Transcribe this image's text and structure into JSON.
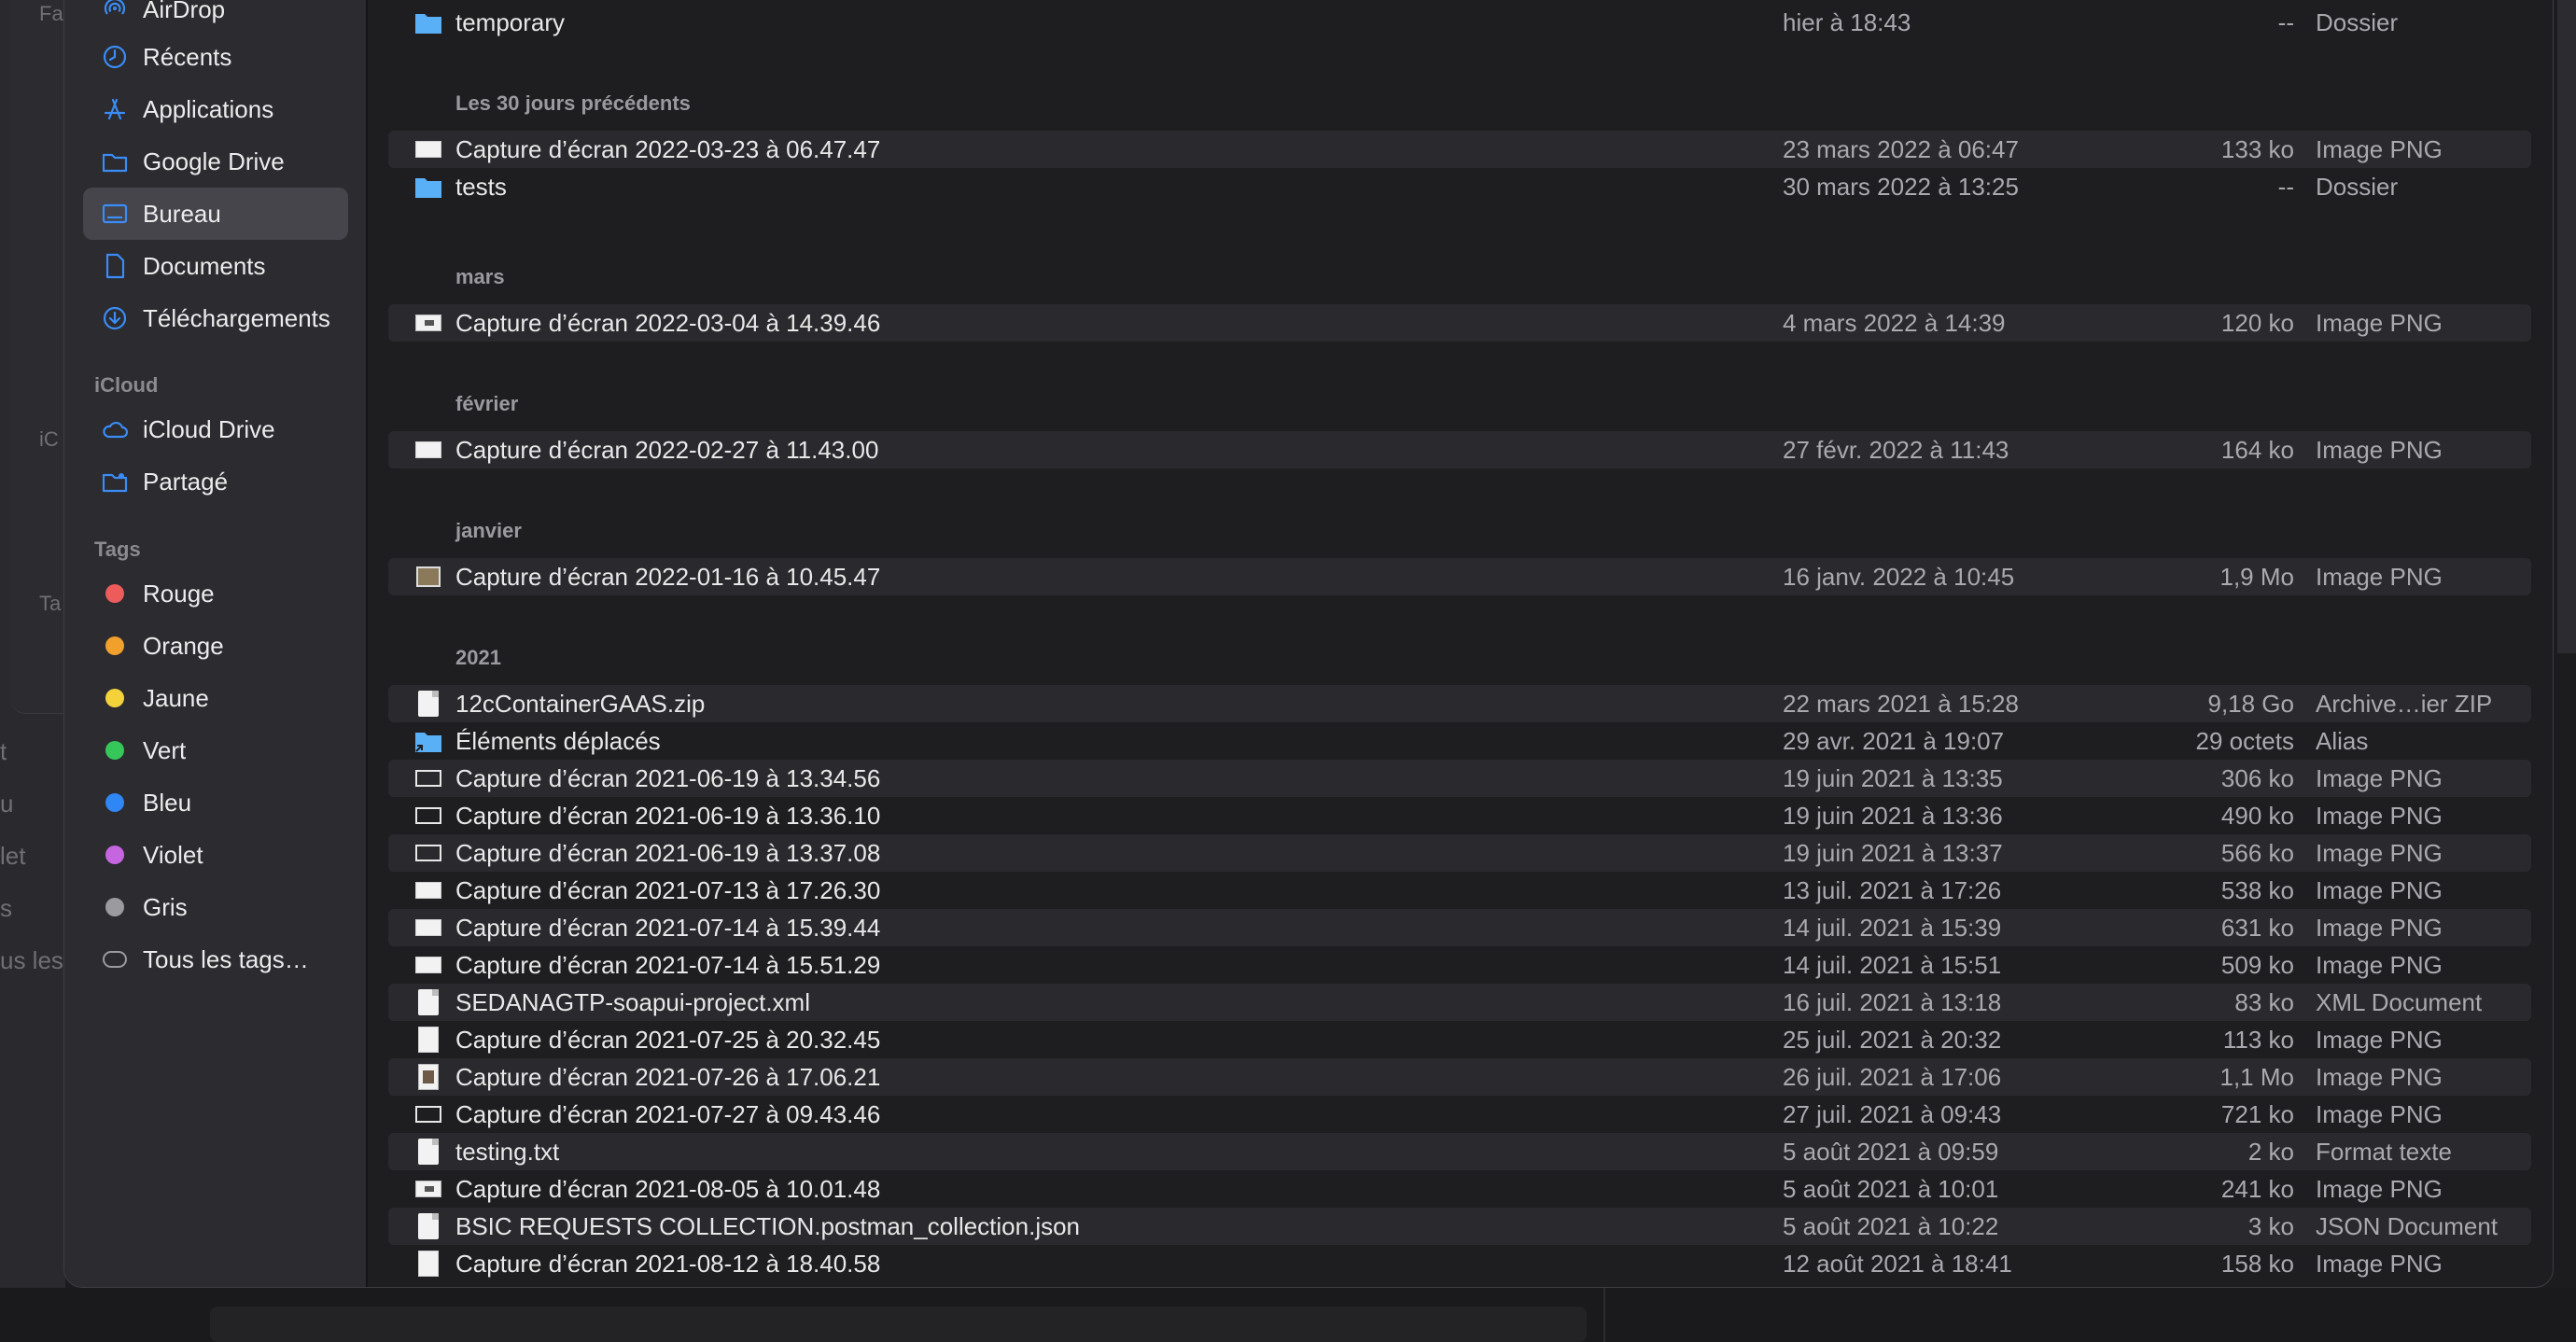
{
  "colors": {
    "accent": "#3b8cf5",
    "folder": "#5ab0f7",
    "tag_rouge": "#ee5b5b",
    "tag_orange": "#f0a02b",
    "tag_jaune": "#f4d33a",
    "tag_vert": "#35c759",
    "tag_bleu": "#2f86f5",
    "tag_violet": "#c665e0",
    "tag_gris": "#9a9a9f"
  },
  "background": {
    "left_texts": [
      "Fa",
      "iC",
      "Ta",
      "t",
      "u",
      "let",
      "s",
      "us les"
    ]
  },
  "sidebar": {
    "favorites": [
      {
        "label": "AirDrop",
        "icon": "airdrop-icon"
      },
      {
        "label": "Récents",
        "icon": "clock-icon"
      },
      {
        "label": "Applications",
        "icon": "applications-icon"
      },
      {
        "label": "Google Drive",
        "icon": "folder-icon"
      },
      {
        "label": "Bureau",
        "icon": "desktop-icon"
      },
      {
        "label": "Documents",
        "icon": "document-icon"
      },
      {
        "label": "Téléchargements",
        "icon": "download-icon"
      }
    ],
    "icloud_header": "iCloud",
    "icloud": [
      {
        "label": "iCloud Drive",
        "icon": "cloud-icon"
      },
      {
        "label": "Partagé",
        "icon": "shared-folder-icon"
      }
    ],
    "tags_header": "Tags",
    "tags": [
      {
        "label": "Rouge",
        "color": "#ee5b5b"
      },
      {
        "label": "Orange",
        "color": "#f0a02b"
      },
      {
        "label": "Jaune",
        "color": "#f4d33a"
      },
      {
        "label": "Vert",
        "color": "#35c759"
      },
      {
        "label": "Bleu",
        "color": "#2f86f5"
      },
      {
        "label": "Violet",
        "color": "#c665e0"
      },
      {
        "label": "Gris",
        "color": "#9a9a9f"
      }
    ],
    "all_tags": "Tous les tags…"
  },
  "list": {
    "top_row": {
      "name": "temporary",
      "date": "hier à 18:43",
      "size": "--",
      "kind": "Dossier",
      "icon": "folder-icon"
    },
    "groups": [
      {
        "title": "Les 30 jours précédents",
        "rows": [
          {
            "name": "Capture d’écran 2022-03-23 à 06.47.47",
            "date": "23 mars 2022 à 06:47",
            "size": "133 ko",
            "kind": "Image PNG",
            "icon": "png-wide-icon"
          },
          {
            "name": "tests",
            "date": "30 mars 2022 à 13:25",
            "size": "--",
            "kind": "Dossier",
            "icon": "folder-icon"
          }
        ]
      },
      {
        "title": "mars",
        "rows": [
          {
            "name": "Capture d’écran 2022-03-04 à 14.39.46",
            "date": "4 mars 2022 à 14:39",
            "size": "120 ko",
            "kind": "Image PNG",
            "icon": "png-dark-icon"
          }
        ]
      },
      {
        "title": "février",
        "rows": [
          {
            "name": "Capture d’écran 2022-02-27 à 11.43.00",
            "date": "27 févr. 2022 à 11:43",
            "size": "164 ko",
            "kind": "Image PNG",
            "icon": "png-wide-icon"
          }
        ]
      },
      {
        "title": "janvier",
        "rows": [
          {
            "name": "Capture d’écran 2022-01-16 à 10.45.47",
            "date": "16 janv. 2022 à 10:45",
            "size": "1,9 Mo",
            "kind": "Image PNG",
            "icon": "photo-icon"
          }
        ]
      },
      {
        "title": "2021",
        "rows": [
          {
            "name": "12cContainerGAAS.zip",
            "date": "22 mars 2021 à 15:28",
            "size": "9,18 Go",
            "kind": "Archive…ier ZIP",
            "icon": "zip-icon"
          },
          {
            "name": "Éléments déplacés",
            "date": "29 avr. 2021 à 19:07",
            "size": "29 octets",
            "kind": "Alias",
            "icon": "alias-folder-icon"
          },
          {
            "name": "Capture d’écran 2021-06-19 à 13.34.56",
            "date": "19 juin 2021 à 13:35",
            "size": "306 ko",
            "kind": "Image PNG",
            "icon": "png-outline-icon"
          },
          {
            "name": "Capture d’écran 2021-06-19 à 13.36.10",
            "date": "19 juin 2021 à 13:36",
            "size": "490 ko",
            "kind": "Image PNG",
            "icon": "png-outline-icon"
          },
          {
            "name": "Capture d’écran 2021-06-19 à 13.37.08",
            "date": "19 juin 2021 à 13:37",
            "size": "566 ko",
            "kind": "Image PNG",
            "icon": "png-outline-icon"
          },
          {
            "name": "Capture d’écran 2021-07-13 à 17.26.30",
            "date": "13 juil. 2021 à 17:26",
            "size": "538 ko",
            "kind": "Image PNG",
            "icon": "png-wide-icon"
          },
          {
            "name": "Capture d’écran 2021-07-14 à 15.39.44",
            "date": "14 juil. 2021 à 15:39",
            "size": "631 ko",
            "kind": "Image PNG",
            "icon": "png-wide-icon"
          },
          {
            "name": "Capture d’écran 2021-07-14 à 15.51.29",
            "date": "14 juil. 2021 à 15:51",
            "size": "509 ko",
            "kind": "Image PNG",
            "icon": "png-wide-icon"
          },
          {
            "name": "SEDANAGTP-soapui-project.xml",
            "date": "16 juil. 2021 à 13:18",
            "size": "83 ko",
            "kind": "XML Document",
            "icon": "document-icon"
          },
          {
            "name": "Capture d’écran 2021-07-25 à 20.32.45",
            "date": "25 juil. 2021 à 20:32",
            "size": "113 ko",
            "kind": "Image PNG",
            "icon": "png-tall-icon"
          },
          {
            "name": "Capture d’écran 2021-07-26 à 17.06.21",
            "date": "26 juil. 2021 à 17:06",
            "size": "1,1 Mo",
            "kind": "Image PNG",
            "icon": "photo-tall-icon"
          },
          {
            "name": "Capture d’écran 2021-07-27 à 09.43.46",
            "date": "27 juil. 2021 à 09:43",
            "size": "721 ko",
            "kind": "Image PNG",
            "icon": "png-outline-icon"
          },
          {
            "name": "testing.txt",
            "date": "5 août 2021 à 09:59",
            "size": "2 ko",
            "kind": "Format texte",
            "icon": "document-icon"
          },
          {
            "name": "Capture d’écran 2021-08-05 à 10.01.48",
            "date": "5 août 2021 à 10:01",
            "size": "241 ko",
            "kind": "Image PNG",
            "icon": "png-dark-icon"
          },
          {
            "name": "BSIC REQUESTS COLLECTION.postman_collection.json",
            "date": "5 août 2021 à 10:22",
            "size": "3 ko",
            "kind": "JSON Document",
            "icon": "document-icon"
          },
          {
            "name": "Capture d’écran 2021-08-12 à 18.40.58",
            "date": "12 août 2021 à 18:41",
            "size": "158 ko",
            "kind": "Image PNG",
            "icon": "png-tall-icon"
          }
        ]
      }
    ]
  }
}
